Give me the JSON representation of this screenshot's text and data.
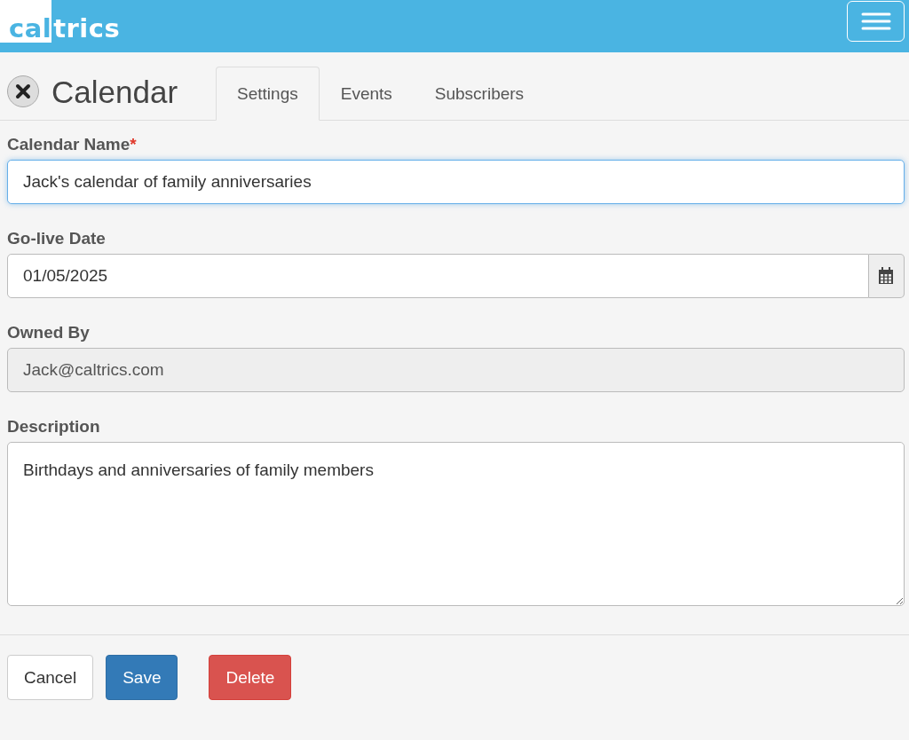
{
  "header": {
    "logo": {
      "on_white": "cal",
      "rest": "trics"
    }
  },
  "page": {
    "title": "Calendar"
  },
  "tabs": [
    {
      "label": "Settings",
      "selected": true
    },
    {
      "label": "Events",
      "selected": false
    },
    {
      "label": "Subscribers",
      "selected": false
    }
  ],
  "required_mark": "*",
  "fields": [
    {
      "kind": "text",
      "label": "Calendar Name",
      "required": true,
      "value": "Jack's calendar of family anniversaries",
      "focused": true
    },
    {
      "kind": "date",
      "label": "Go-live Date",
      "required": false,
      "value": "01/05/2025",
      "focused": false
    },
    {
      "kind": "readonly",
      "label": "Owned By",
      "required": false,
      "value": "Jack@caltrics.com",
      "focused": false
    },
    {
      "kind": "textarea",
      "label": "Description",
      "required": false,
      "value": "Birthdays and anniversaries of family members",
      "focused": false
    }
  ],
  "buttons": [
    {
      "kind": "default",
      "label": "Cancel"
    },
    {
      "kind": "primary",
      "label": "Save"
    },
    {
      "kind": "danger",
      "label": "Delete"
    }
  ]
}
